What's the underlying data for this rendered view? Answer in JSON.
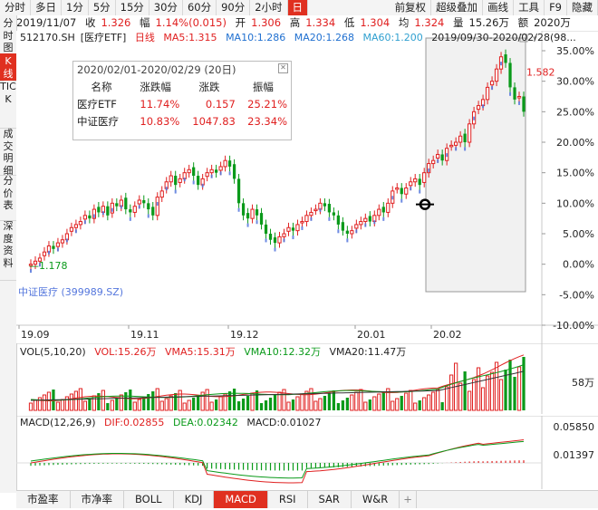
{
  "toolbar": {
    "items": [
      "分时",
      "多日",
      "1分",
      "5分",
      "15分",
      "30分",
      "60分",
      "90分",
      "2小时",
      "日",
      "前复权",
      "超级叠加",
      "画线",
      "工具",
      "F9",
      "隐藏"
    ],
    "active_index": 9
  },
  "quote": {
    "date": "2019/11/07",
    "close_label": "收",
    "close": "1.326",
    "change_label": "幅",
    "change": "1.14%(0.015)",
    "open_label": "开",
    "open": "1.306",
    "high_label": "高",
    "high": "1.334",
    "low_label": "低",
    "low": "1.304",
    "avg_label": "均",
    "avg": "1.324",
    "volume_label": "量",
    "volume": "15.26万",
    "amount_label": "额",
    "amount": "2020万"
  },
  "left_tabs": [
    "分时图",
    "K线图",
    "TICK",
    "成交明细",
    "分价表",
    "深度资料"
  ],
  "left_active_index": 1,
  "price_chart": {
    "code": "512170.SH",
    "name": "[医疗ETF]",
    "period": "日线",
    "ma5": "MA5:1.315",
    "ma10": "MA10:1.286",
    "ma20": "MA20:1.268",
    "ma60": "MA60:1.200",
    "range": "2019/09/30-2020/02/28(98...",
    "low_marker": "1.178",
    "high_marker": "1.582",
    "overlay_label": "中证医疗 (399989.SZ)",
    "y_ticks": [
      "35.00%",
      "30.00%",
      "25.00%",
      "20.00%",
      "15.00%",
      "10.00%",
      "5.00%",
      "0.00%",
      "-5.00%",
      "-10.00%"
    ],
    "x_ticks": [
      "19.09",
      "19.11",
      "19.12",
      "20.01",
      "20.02"
    ]
  },
  "popup": {
    "title": "2020/02/01-2020/02/29 (20日)",
    "headers": [
      "名称",
      "涨跌幅",
      "涨跌",
      "振幅"
    ],
    "rows": [
      {
        "name": "医疗ETF",
        "pct": "11.74%",
        "chg": "0.157",
        "amp": "25.21%"
      },
      {
        "name": "中证医疗",
        "pct": "10.83%",
        "chg": "1047.83",
        "amp": "23.34%"
      }
    ]
  },
  "volume": {
    "title": "VOL(5,10,20)",
    "vol": "VOL:15.26万",
    "vma5": "VMA5:15.31万",
    "vma10": "VMA10:12.32万",
    "vma20": "VMA20:11.47万",
    "y_tick": "58万"
  },
  "macd": {
    "title": "MACD(12,26,9)",
    "dif": "DIF:0.02855",
    "dea": "DEA:0.02342",
    "macd": "MACD:0.01027",
    "y_ticks": [
      "0.05850",
      "0.01397"
    ]
  },
  "bottom_tabs": [
    "市盈率",
    "市净率",
    "BOLL",
    "KDJ",
    "MACD",
    "RSI",
    "SAR",
    "W&R",
    "+"
  ],
  "bottom_active_index": 4,
  "colors": {
    "up": "#e02020",
    "down": "#0a9a1a",
    "accent": "#e03020",
    "overlay": "#5577dd"
  },
  "chart_data": {
    "type": "candlestick",
    "x_ticks": [
      "19.09",
      "19.11",
      "19.12",
      "20.01",
      "20.02"
    ],
    "ylim_pct": [
      -10,
      35
    ],
    "close_pct": [
      0,
      0.5,
      1,
      2,
      3,
      2.5,
      3.5,
      4,
      5,
      6,
      6.5,
      7,
      8,
      7.5,
      9,
      8.5,
      9.5,
      8,
      10,
      9.5,
      10.5,
      9,
      8.5,
      9.5,
      10.5,
      10,
      9,
      8,
      11,
      12,
      13.5,
      14.5,
      13,
      14,
      15,
      15.5,
      14.5,
      13,
      14,
      15,
      15.5,
      15,
      16,
      17,
      16,
      14,
      10,
      8,
      7.5,
      9,
      8,
      6.5,
      5,
      4,
      3.5,
      4.5,
      5,
      6,
      5.5,
      6.5,
      7,
      8,
      8.5,
      9,
      10,
      9.5,
      8.5,
      8,
      6.5,
      5.5,
      5,
      5.5,
      6.5,
      7,
      7.5,
      7,
      8,
      9,
      8.5,
      10,
      12,
      12.5,
      11.5,
      12.5,
      13.5,
      14,
      13,
      15,
      16.5,
      17,
      18,
      17,
      19,
      19.5,
      20,
      21,
      20,
      23,
      25,
      26,
      27,
      29,
      30,
      32,
      34,
      33,
      29,
      27,
      27.5,
      25
    ],
    "low_marker_value": 1.178,
    "high_marker_value": 1.582,
    "overlay_series": "中证医疗 (399989.SZ)"
  }
}
